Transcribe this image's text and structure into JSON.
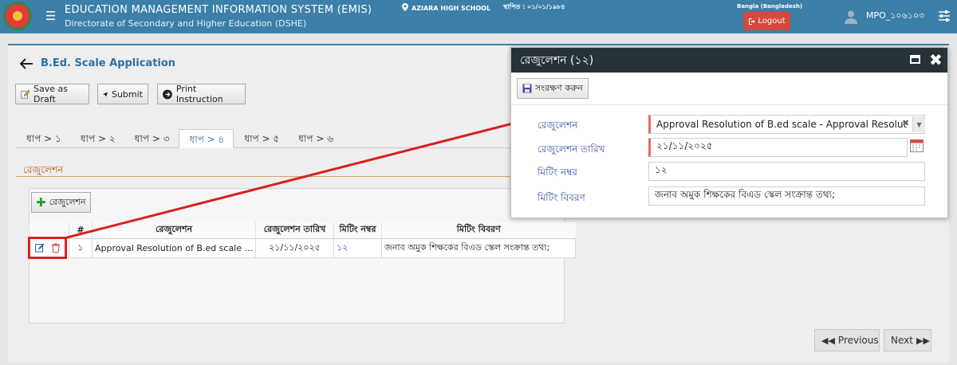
{
  "header": {
    "title": "EDUCATION MANAGEMENT INFORMATION SYSTEM (EMIS)",
    "subtitle": "Directorate of Secondary and Higher Education (DSHE)",
    "school": "AZIARA HIGH SCHOOL",
    "established": "স্থাপিত : ০১/০১/১৯৮৪",
    "language": "Bangla (Bangladesh)",
    "logout_label": "Logout",
    "username": "MPO_১০৬১০৩"
  },
  "page": {
    "title": "B.Ed. Scale Application"
  },
  "toolbar": {
    "save_draft_label": "Save as Draft",
    "submit_label": "Submit",
    "print_label": "Print Instruction"
  },
  "steps": [
    "ধাপ > ১",
    "ধাপ > ২",
    "ধাপ > ৩",
    "ধাপ > ৪",
    "ধাপ > ৫",
    "ধাপ > ৬"
  ],
  "active_step": 3,
  "section": {
    "label": "রেজুলেশন",
    "add_button_label": "রেজুলেশন"
  },
  "grid": {
    "columns": [
      "#",
      "রেজুলেশন",
      "রেজুলেশন তারিখ",
      "মিটিং নম্বর",
      "মিটিং বিবরণ"
    ],
    "rows": [
      {
        "no": "১",
        "resolution": "Approval Resolution of B.ed scale ...",
        "date": "২১/১১/২০২৫",
        "meeting_no": "১২",
        "meeting_desc": "জনাব অমুক শিক্ষকের বিএড স্কেল সংক্রান্ত তথ্য;"
      }
    ]
  },
  "pager": {
    "previous_label": "Previous",
    "next_label": "Next"
  },
  "modal": {
    "title": "রেজুলেশন (১২)",
    "save_label": "সংরক্ষণ করুন",
    "fields": {
      "resolution_label": "রেজুলেশন",
      "resolution_value": "Approval Resolution of B.ed scale - Approval Resolution o...",
      "date_label": "রেজুলেশন তারিখ",
      "date_value": "২১/১১/২০২৫",
      "meeting_no_label": "মিটিং নম্বর",
      "meeting_no_value": "১২",
      "meeting_desc_label": "মিটিং বিবরণ",
      "meeting_desc_value": "জনাব অমুক শিক্ষকের বিএড স্কেল সংক্রান্ত তথ্য;"
    }
  },
  "colors": {
    "header_bg": "#3c7fa8",
    "accent_blue": "#2d6fa3",
    "logout_red": "#d24b3c",
    "annotation_red": "#d92020",
    "modal_header": "#263339"
  }
}
